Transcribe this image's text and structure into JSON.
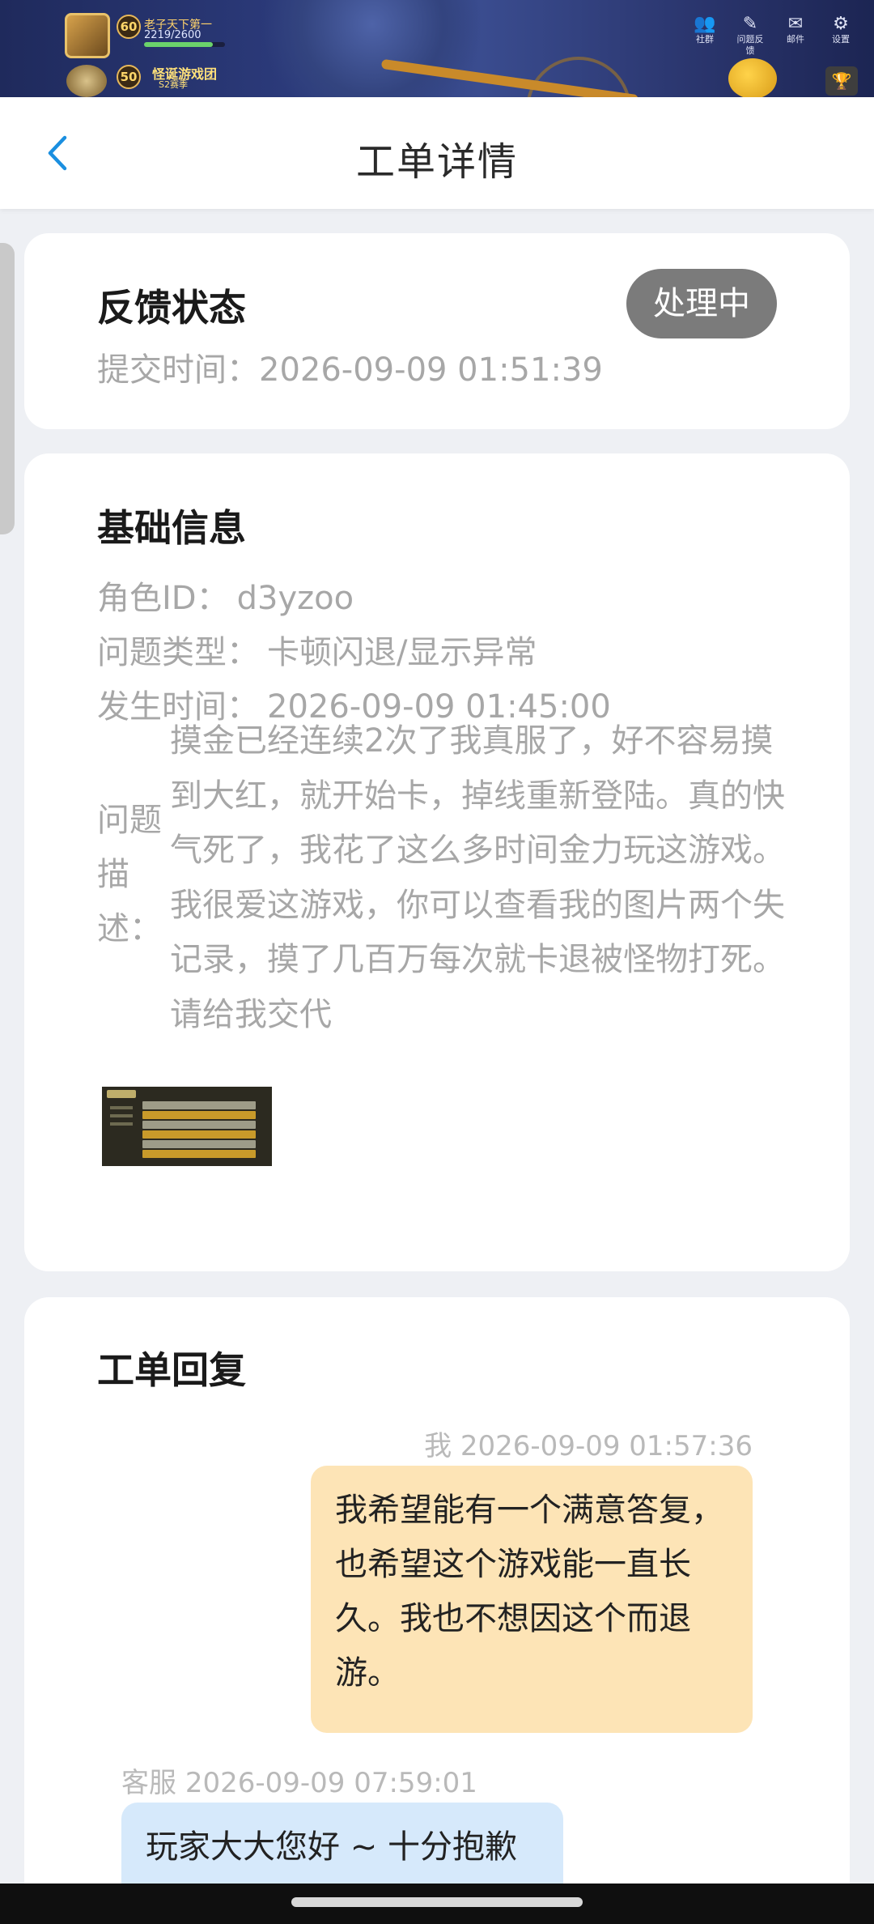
{
  "game_bar": {
    "level_top": "60",
    "level_bottom": "50",
    "player_name": "老子天下第一",
    "exp": "2219/2600",
    "event_title": "怪诞游戏团",
    "event_sub": "S2赛季",
    "icons": [
      {
        "icon": "community-icon",
        "glyph": "👥",
        "label": "社群"
      },
      {
        "icon": "feedback-icon",
        "glyph": "✎",
        "label": "问题反馈"
      },
      {
        "icon": "mail-icon",
        "glyph": "✉",
        "label": "邮件"
      },
      {
        "icon": "settings-icon",
        "glyph": "⚙",
        "label": "设置"
      }
    ],
    "trophy_glyph": "🏆"
  },
  "header": {
    "title": "工单详情"
  },
  "status_card": {
    "title": "反馈状态",
    "status": "处理中",
    "submit_label": "提交时间：",
    "submit_time": "2026-09-09 01:51:39"
  },
  "info_card": {
    "title": "基础信息",
    "role_id_label": "角色ID：",
    "role_id": "d3yzoo",
    "type_label": "问题类型：",
    "type": "卡顿闪退/显示异常",
    "occur_label": "发生时间：",
    "occur_time": "2026-09-09 01:45:00",
    "desc_label": "问题描述：",
    "desc": "摸金已经连续2次了我真服了，好不容易摸到大红，就开始卡，掉线重新登陆。真的快气死了，我花了这么多时间金力玩这游戏。我很爱这游戏，你可以查看我的图片两个失记录，摸了几百万每次就卡退被怪物打死。请给我交代"
  },
  "reply_card": {
    "title": "工单回复",
    "messages": [
      {
        "sender": "我",
        "time": "2026-09-09 01:57:36",
        "text": "我希望能有一个满意答复，也希望这个游戏能一直长久。我也不想因这个而退游。"
      },
      {
        "sender": "客服",
        "time": "2026-09-09 07:59:01",
        "text": "玩家大大您好 ~ 十分抱歉"
      }
    ]
  },
  "colors": {
    "accent_blue": "#1a8fe0",
    "status_badge": "#7b7b7b",
    "bubble_me": "#fde4b6",
    "bubble_cs": "#d6e9fb"
  }
}
